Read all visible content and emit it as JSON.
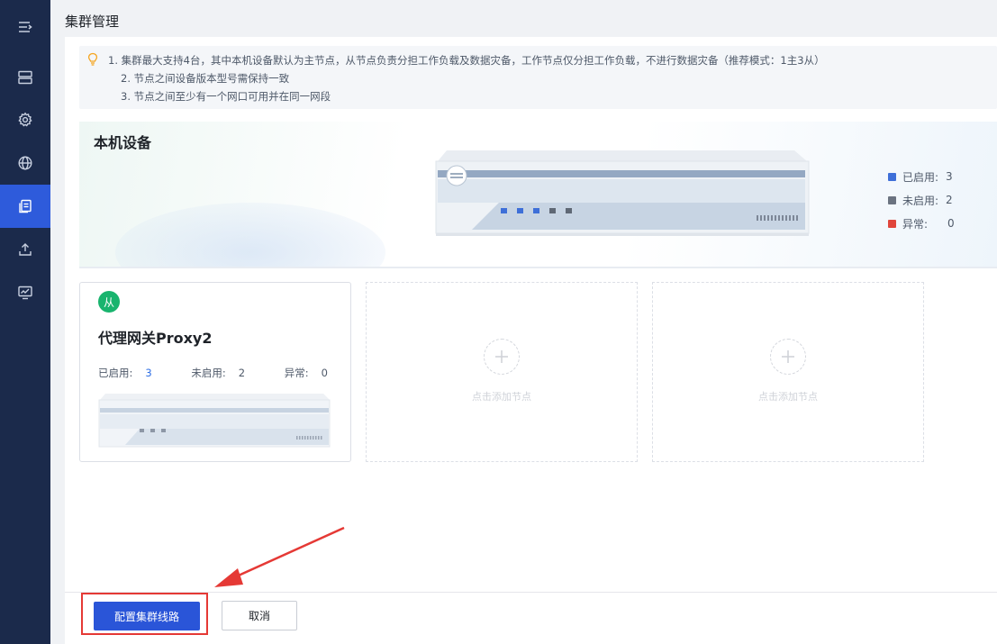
{
  "page": {
    "title": "集群管理"
  },
  "sidebar": {
    "items": [
      {
        "icon": "menu-collapse-icon",
        "active": false
      },
      {
        "icon": "server-icon",
        "active": false
      },
      {
        "icon": "gear-icon",
        "active": false
      },
      {
        "icon": "globe-icon",
        "active": false
      },
      {
        "icon": "cluster-icon",
        "active": true
      },
      {
        "icon": "upload-icon",
        "active": false
      },
      {
        "icon": "monitor-icon",
        "active": false
      }
    ]
  },
  "tips": {
    "line1": "1. 集群最大支持4台，其中本机设备默认为主节点，从节点负责分担工作负载及数据灾备，工作节点仅分担工作负载，不进行数据灾备（推荐模式：1主3从）",
    "line2": "2. 节点之间设备版本型号需保持一致",
    "line3": "3. 节点之间至少有一个网口可用并在同一网段"
  },
  "local_device": {
    "title": "本机设备",
    "legend": [
      {
        "label": "已启用:",
        "value": "3",
        "color": "#3e6fd8"
      },
      {
        "label": "未启用:",
        "value": "2",
        "color": "#6b7380"
      },
      {
        "label": "异常:",
        "value": "0",
        "color": "#e0453b"
      }
    ]
  },
  "nodes": [
    {
      "badge": "从",
      "name": "代理网关Proxy2",
      "enabled_label": "已启用:",
      "enabled_value": "3",
      "disabled_label": "未启用:",
      "disabled_value": "2",
      "error_label": "异常:",
      "error_value": "0"
    }
  ],
  "empty_slots": [
    {
      "label": "点击添加节点"
    },
    {
      "label": "点击添加节点"
    }
  ],
  "footer": {
    "primary_label": "配置集群线路",
    "cancel_label": "取消"
  },
  "colors": {
    "sidebar_bg": "#1b2a4b",
    "accent": "#2e5bdb",
    "primary_button": "#2a55d8",
    "annotation_red": "#e53935",
    "badge_green": "#19b46e"
  }
}
